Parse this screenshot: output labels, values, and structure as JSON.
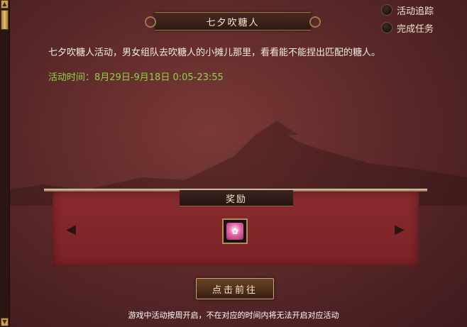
{
  "header": {
    "title": "七夕吹糖人"
  },
  "options": {
    "track_label": "活动追踪",
    "complete_label": "完成任务"
  },
  "activity": {
    "description": "七夕吹糖人活动，男女组队去吹糖人的小摊儿那里，看看能不能捏出匹配的糖人。",
    "time_label": "活动时间：",
    "time_value": "8月29日-9月18日 0:05-23:55"
  },
  "reward": {
    "title": "奖励",
    "item_icon": "gift-box-icon"
  },
  "actions": {
    "go_label": "点击前往"
  },
  "footer": {
    "note": "游戏中活动按周开启，不在对应的时间内将无法开启对应活动"
  },
  "colors": {
    "time_text": "#8fd24a",
    "panel_red": "#8a2a2e",
    "gold_border": "#c8a56a"
  }
}
